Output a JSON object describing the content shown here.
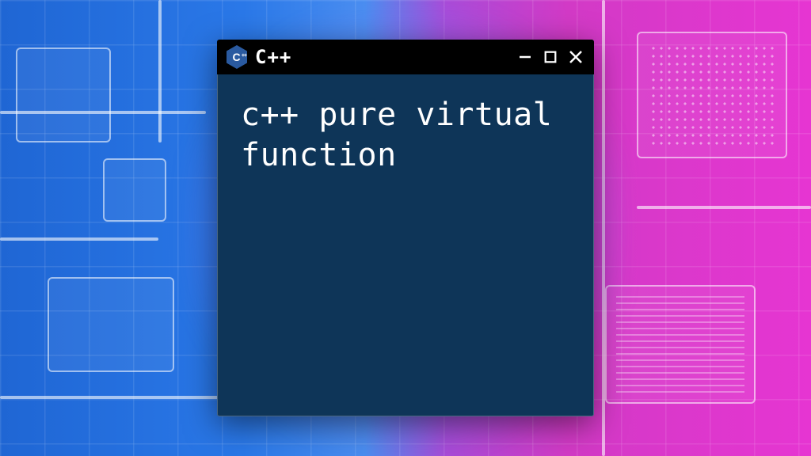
{
  "titlebar": {
    "icon_name": "cpp-hex-icon",
    "icon_letter": "C",
    "icon_plus": "++",
    "title": "C++"
  },
  "content": {
    "text": "c++ pure virtual function"
  },
  "colors": {
    "window_bg": "#0e3558",
    "titlebar_bg": "#000000",
    "text": "#ffffff",
    "bg_left": "#2a78e8",
    "bg_right": "#e635d2",
    "icon_hex": "#2a5aa0"
  }
}
